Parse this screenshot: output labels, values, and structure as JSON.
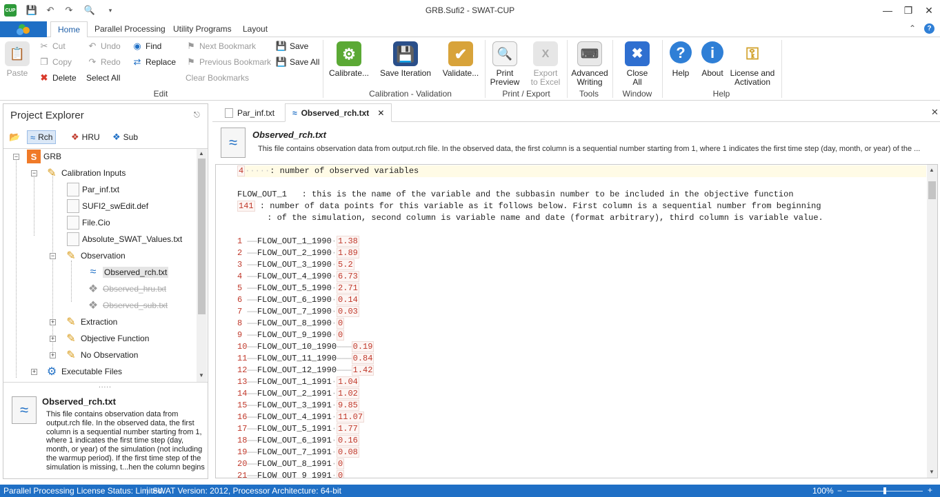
{
  "window": {
    "title": "GRB.Sufi2 - SWAT-CUP"
  },
  "ribbon_tabs": [
    "Home",
    "Parallel Processing",
    "Utility Programs",
    "Layout"
  ],
  "ribbon": {
    "paste": "Paste",
    "cut": "Cut",
    "copy": "Copy",
    "delete": "Delete",
    "undo": "Undo",
    "redo": "Redo",
    "select_all": "Select All",
    "find": "Find",
    "replace": "Replace",
    "next_bookmark": "Next Bookmark",
    "previous_bookmark": "Previous Bookmark",
    "clear_bookmarks": "Clear Bookmarks",
    "save": "Save",
    "save_all": "Save All",
    "edit_group": "Edit",
    "calibrate": "Calibrate...",
    "save_iteration": "Save Iteration",
    "validate": "Validate...",
    "calibration_group": "Calibration - Validation",
    "print_preview_1": "Print",
    "print_preview_2": "Preview",
    "export_excel_1": "Export",
    "export_excel_2": "to Excel",
    "print_group": "Print / Export",
    "advanced_writing_1": "Advanced",
    "advanced_writing_2": "Writing",
    "tools_group": "Tools",
    "close_all_1": "Close",
    "close_all_2": "All",
    "window_group": "Window",
    "help": "Help",
    "about": "About",
    "license_1": "License and",
    "license_2": "Activation",
    "help_group": "Help"
  },
  "explorer": {
    "title": "Project Explorer",
    "toolbar": [
      "Rch",
      "HRU",
      "Sub"
    ],
    "tree": {
      "root": "GRB",
      "calibration_inputs": "Calibration Inputs",
      "par_inf": "Par_inf.txt",
      "sufi2_swedit": "SUFI2_swEdit.def",
      "file_cio": "File.Cio",
      "absolute_values": "Absolute_SWAT_Values.txt",
      "observation": "Observation",
      "observed_rch": "Observed_rch.txt",
      "observed_hru": "Observed_hru.txt",
      "observed_sub": "Observed_sub.txt",
      "extraction": "Extraction",
      "objective_function": "Objective Function",
      "no_observation": "No Observation",
      "executable_files": "Executable Files"
    },
    "description": {
      "title": "Observed_rch.txt",
      "body": "This file contains observation data from output.rch file. In the observed data, the first column is a sequential number starting from 1, where 1 indicates the first time step (day, month, or year) of the simulation (not including the warmup period). If the first time step of the simulation is missing, t...hen the column begins"
    }
  },
  "doc_tabs": [
    "Par_inf.txt",
    "Observed_rch.txt"
  ],
  "doc": {
    "title": "Observed_rch.txt",
    "description": "This file contains observation data from output.rch file. In the observed data, the first column is a sequential number starting from 1, where 1 indicates the first time step (day, month, or year) of the ..."
  },
  "editor": {
    "header": {
      "count": "4",
      "label": "number of observed variables"
    },
    "variable_line": "FLOW_OUT_1   : this is the name of the variable and the subbasin number to be included in the objective function",
    "points": {
      "count": "141",
      "text": " : number of data points for this variable as it follows below. First column is a sequential number from beginning"
    },
    "points_cont": "      : of the simulation, second column is variable name and date (format arbitrary), third column is variable value.",
    "rows": [
      {
        "n": "1",
        "name": "FLOW_OUT_1_1990",
        "v": "1.38"
      },
      {
        "n": "2",
        "name": "FLOW_OUT_2_1990",
        "v": "1.89"
      },
      {
        "n": "3",
        "name": "FLOW_OUT_3_1990",
        "v": "5.2"
      },
      {
        "n": "4",
        "name": "FLOW_OUT_4_1990",
        "v": "6.73"
      },
      {
        "n": "5",
        "name": "FLOW_OUT_5_1990",
        "v": "2.71"
      },
      {
        "n": "6",
        "name": "FLOW_OUT_6_1990",
        "v": "0.14"
      },
      {
        "n": "7",
        "name": "FLOW_OUT_7_1990",
        "v": "0.03"
      },
      {
        "n": "8",
        "name": "FLOW_OUT_8_1990",
        "v": "0"
      },
      {
        "n": "9",
        "name": "FLOW_OUT_9_1990",
        "v": "0"
      },
      {
        "n": "10",
        "name": "FLOW_OUT_10_1990",
        "v": "0.19"
      },
      {
        "n": "11",
        "name": "FLOW_OUT_11_1990",
        "v": "0.84"
      },
      {
        "n": "12",
        "name": "FLOW_OUT_12_1990",
        "v": "1.42"
      },
      {
        "n": "13",
        "name": "FLOW_OUT_1_1991",
        "v": "1.04"
      },
      {
        "n": "14",
        "name": "FLOW_OUT_2_1991",
        "v": "1.02"
      },
      {
        "n": "15",
        "name": "FLOW_OUT_3_1991",
        "v": "9.85"
      },
      {
        "n": "16",
        "name": "FLOW_OUT_4_1991",
        "v": "11.07"
      },
      {
        "n": "17",
        "name": "FLOW_OUT_5_1991",
        "v": "1.77"
      },
      {
        "n": "18",
        "name": "FLOW_OUT_6_1991",
        "v": "0.16"
      },
      {
        "n": "19",
        "name": "FLOW_OUT_7_1991",
        "v": "0.08"
      },
      {
        "n": "20",
        "name": "FLOW_OUT_8_1991",
        "v": "0"
      },
      {
        "n": "21",
        "name": "FLOW_OUT_9_1991",
        "v": "0"
      }
    ]
  },
  "status": {
    "license": "Parallel Processing License Status: Limited",
    "version": "SWAT Version: 2012, Processor Architecture: 64-bit",
    "zoom": "100%"
  },
  "colors": {
    "accent": "#1f6fc5",
    "number": "#c0392b"
  }
}
